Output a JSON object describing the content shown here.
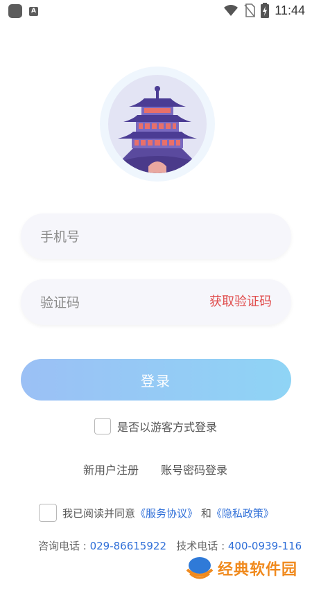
{
  "status_bar": {
    "time": "11:44",
    "icons": [
      "app-square-icon",
      "a-badge-icon",
      "wifi-icon",
      "no-sim-icon",
      "battery-charging-icon"
    ]
  },
  "logo": {
    "icon": "bell-tower-icon"
  },
  "phone_field": {
    "placeholder": "手机号",
    "value": ""
  },
  "code_field": {
    "placeholder": "验证码",
    "value": "",
    "action_label": "获取验证码"
  },
  "login_button": {
    "label": "登录"
  },
  "guest": {
    "label": "是否以游客方式登录",
    "checked": false
  },
  "links": {
    "register": "新用户注册",
    "password_login": "账号密码登录"
  },
  "agreement": {
    "prefix": "我已阅读并同意",
    "service": "《服务协议》",
    "and": "和",
    "privacy": "《隐私政策》",
    "checked": false
  },
  "contact": {
    "consult_label": "咨询电话 : ",
    "consult_number": "029-86615922",
    "tech_label": "技术电话 : ",
    "tech_number": "400-0939-116"
  },
  "watermark": {
    "text": "经典软件园"
  },
  "colors": {
    "accent_red": "#e04b4b",
    "link_blue": "#2f6fd8",
    "button_gradient_start": "#9bc0f5",
    "button_gradient_end": "#8fd4f5",
    "watermark_orange": "#f08a1e"
  }
}
